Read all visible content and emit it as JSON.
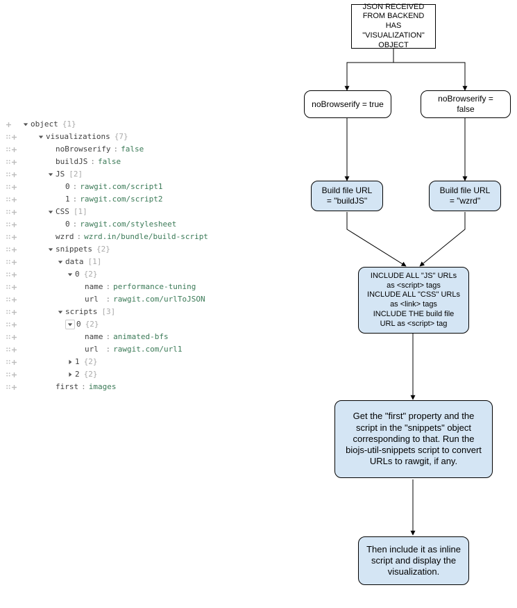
{
  "tree": {
    "root_label": "object",
    "root_meta": "{1}",
    "visualizations_label": "visualizations",
    "visualizations_meta": "{7}",
    "noBrowserify_key": "noBrowserify",
    "noBrowserify_val": "false",
    "buildJS_key": "buildJS",
    "buildJS_val": "false",
    "JS_label": "JS",
    "JS_meta": "[2]",
    "JS_0_key": "0",
    "JS_0_val": "rawgit.com/script1",
    "JS_1_key": "1",
    "JS_1_val": "rawgit.com/script2",
    "CSS_label": "CSS",
    "CSS_meta": "[1]",
    "CSS_0_key": "0",
    "CSS_0_val": "rawgit.com/stylesheet",
    "wzrd_key": "wzrd",
    "wzrd_val": "wzrd.in/bundle/build-script",
    "snippets_label": "snippets",
    "snippets_meta": "{2}",
    "data_label": "data",
    "data_meta": "[1]",
    "data_0_key": "0",
    "data_0_meta": "{2}",
    "data_0_name_key": "name",
    "data_0_name_val": "performance-tuning",
    "data_0_url_key": "url",
    "data_0_url_val": "rawgit.com/urlToJSON",
    "scripts_label": "scripts",
    "scripts_meta": "[3]",
    "scripts_0_key": "0",
    "scripts_0_meta": "{2}",
    "scripts_0_name_key": "name",
    "scripts_0_name_val": "animated-bfs",
    "scripts_0_url_key": "url",
    "scripts_0_url_val": "rawgit.com/url1",
    "scripts_1_key": "1",
    "scripts_1_meta": "{2}",
    "scripts_2_key": "2",
    "scripts_2_meta": "{2}",
    "first_key": "first",
    "first_val": "images"
  },
  "flow": {
    "top": "JSON RECEIVED FROM BACKEND HAS \"VISUALIZATION\" OBJECT",
    "branch_true": "noBrowserify = true",
    "branch_false": "noBrowserify = false",
    "build_true": "Build file URL = \"buildJS\"",
    "build_false": "Build file URL = \"wzrd\"",
    "include": "INCLUDE ALL \"JS\" URLs as <script> tags\nINCLUDE ALL \"CSS\" URLs as <link> tags\nINCLUDE THE build file URL as <script> tag",
    "first": "Get the \"first\" property and the script in the \"snippets\" object corresponding to that. Run the biojs-util-snippets script to convert URLs to rawgit, if any.",
    "final": "Then include it as inline script and display the visualization."
  }
}
